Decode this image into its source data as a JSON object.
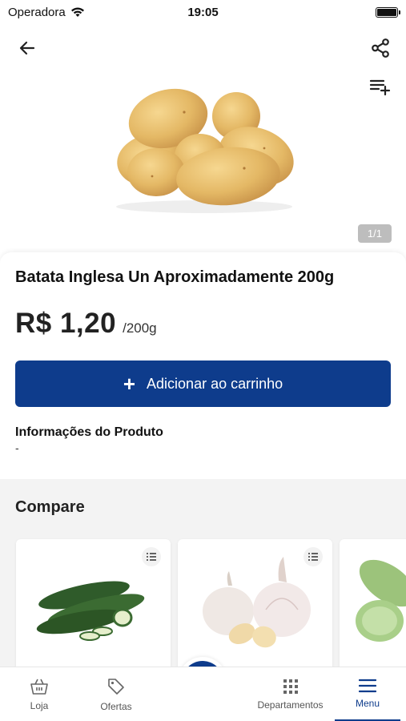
{
  "status_bar": {
    "carrier": "Operadora",
    "time": "19:05"
  },
  "product": {
    "image_alt": "Batata inglesa",
    "pager": "1/1",
    "title": "Batata Inglesa Un Aproximadamente 200g",
    "price": "R$ 1,20",
    "unit": "/200g",
    "add_to_cart_label": "Adicionar ao carrinho",
    "info_title": "Informações do Produto",
    "info_value": "-"
  },
  "compare": {
    "title": "Compare",
    "items": [
      {
        "name": "Pepino"
      },
      {
        "name": "Alho"
      },
      {
        "name": "Abobrinha"
      }
    ]
  },
  "bottom_nav": {
    "items": [
      {
        "label": "Loja",
        "icon": "basket-icon"
      },
      {
        "label": "Ofertas",
        "icon": "tag-icon"
      },
      {
        "label": "Departamentos",
        "icon": "grid-icon"
      },
      {
        "label": "Menu",
        "icon": "menu-icon",
        "active": true
      }
    ]
  },
  "colors": {
    "primary": "#0e3c8c",
    "compare_bg": "#f3f3f3"
  }
}
